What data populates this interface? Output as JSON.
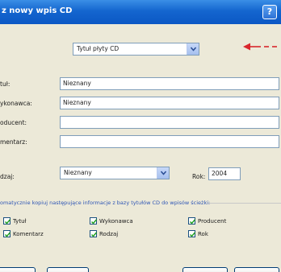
{
  "window": {
    "title": "z nowy wpis CD",
    "help_label": "?"
  },
  "colors": {
    "titlebar": "#0b57c4",
    "annotation_arrow": "#d9262c",
    "panel": "#ece9d8",
    "section_text": "#2f56b5"
  },
  "top_select": {
    "value": "Tytuł płyty CD"
  },
  "fields": {
    "tytul": {
      "label": "tuł:",
      "value": "Nieznany"
    },
    "wykonawca": {
      "label": "ykonawca:",
      "value": "Nieznany"
    },
    "producent": {
      "label": "oducent:",
      "value": ""
    },
    "komentarz": {
      "label": "mentarz:",
      "value": ""
    },
    "rodzaj": {
      "label": "dzaj:",
      "value": "Nieznany"
    },
    "rok": {
      "label": "Rok:",
      "value": "2004"
    }
  },
  "section": {
    "text": "omatycznie kopiuj następujące informacje z bazy tytułów CD do wpisów ścieżki:"
  },
  "checkboxes": [
    {
      "label": "Tytuł",
      "checked": true
    },
    {
      "label": "Wykonawca",
      "checked": true
    },
    {
      "label": "Producent",
      "checked": true
    },
    {
      "label": "Komentarz",
      "checked": true
    },
    {
      "label": "Rodzaj",
      "checked": true
    },
    {
      "label": "Rok",
      "checked": true
    }
  ],
  "icons": {
    "help": "help-icon",
    "arrow": "red-annotation-arrow",
    "dropdown": "chevron-down-icon",
    "check": "check-icon"
  }
}
